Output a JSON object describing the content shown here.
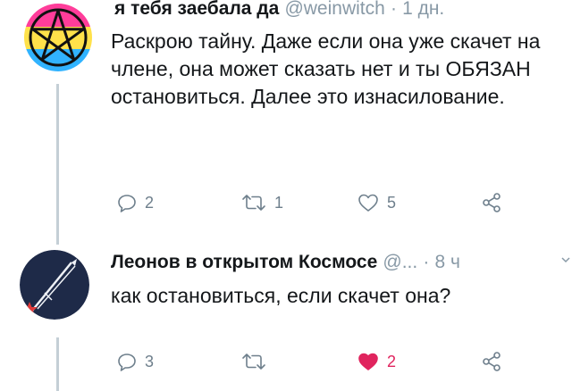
{
  "tweets": [
    {
      "display_name": "я тебя заебала да",
      "handle": "@weinwitch",
      "separator": "·",
      "time": "1 дн.",
      "text": "Раскрою тайну. Даже если она уже скачет на члене, она может сказать нет и ты ОБЯЗАН остановиться. Далее это изнасилование.",
      "reply_count": "2",
      "retweet_count": "1",
      "like_count": "5",
      "liked": false
    },
    {
      "display_name": "Леонов в открытом Космосе",
      "handle": "@...",
      "separator": "·",
      "time": "8 ч",
      "text": "как остановиться, если скачет она?",
      "reply_count": "3",
      "retweet_count": "",
      "like_count": "2",
      "liked": true
    }
  ],
  "icons": {
    "reply": "reply-icon",
    "retweet": "retweet-icon",
    "like": "heart-icon",
    "share": "share-icon",
    "more": "chevron-down-icon"
  },
  "colors": {
    "text": "#14171a",
    "muted": "#8899a6",
    "icon": "#6e7f8c",
    "like_active": "#e0245e",
    "thread_line": "#c4cfd6",
    "avatar1_band_top": "#ff3d9a",
    "avatar1_band_mid": "#ffe14a",
    "avatar1_band_bottom": "#31b3ff",
    "avatar2_bg": "#1e2a48",
    "avatar2_star": "#e03a3a"
  }
}
